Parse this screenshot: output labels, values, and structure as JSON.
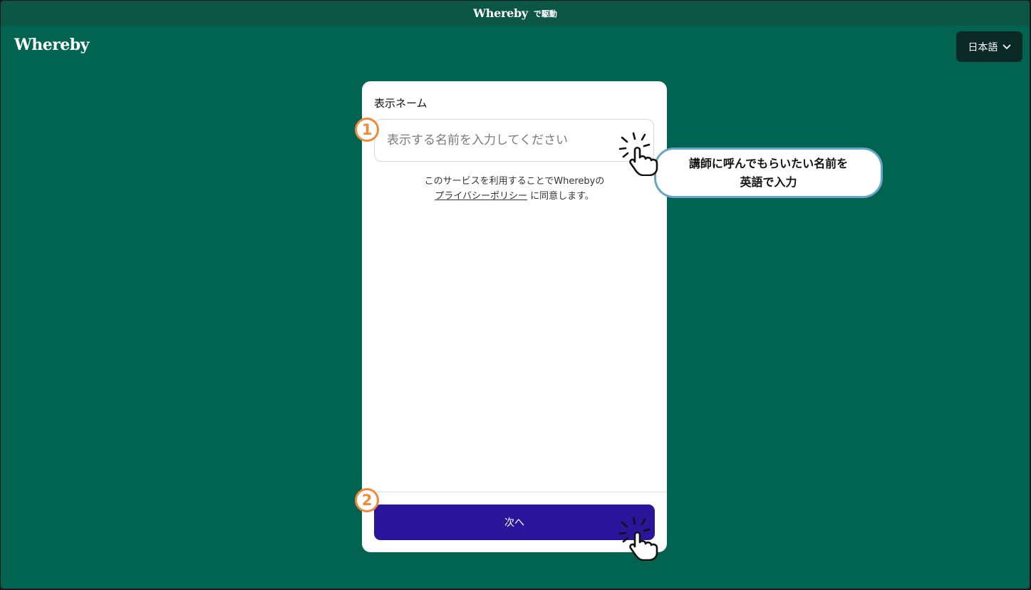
{
  "topbar": {
    "brand": "Whereby",
    "powered_text": "で駆動"
  },
  "header": {
    "logo": "Whereby",
    "language_button": "日本語",
    "language_icon": "chevron-down-icon"
  },
  "card": {
    "label": "表示ネーム",
    "name_input": {
      "value": "",
      "placeholder": "表示する名前を入力してください"
    },
    "terms_text": "このサービスを利用することでWherebyの",
    "privacy_link": "プライバシーポリシー",
    "terms_suffix": " に同意します。",
    "next_button": "次へ"
  },
  "annotations": {
    "step1": "1",
    "step2": "2",
    "callout_line1": "講師に呼んでもらいたい名前を",
    "callout_line2": "英語で入力",
    "hand_icon": "pointing-hand-icon",
    "accent_orange": "#f08a3a",
    "callout_border": "#6aa3c8"
  },
  "colors": {
    "background": "#006451",
    "topbar": "#0b5644",
    "button_primary": "#2b169b",
    "language_button": "#0c2a25"
  }
}
